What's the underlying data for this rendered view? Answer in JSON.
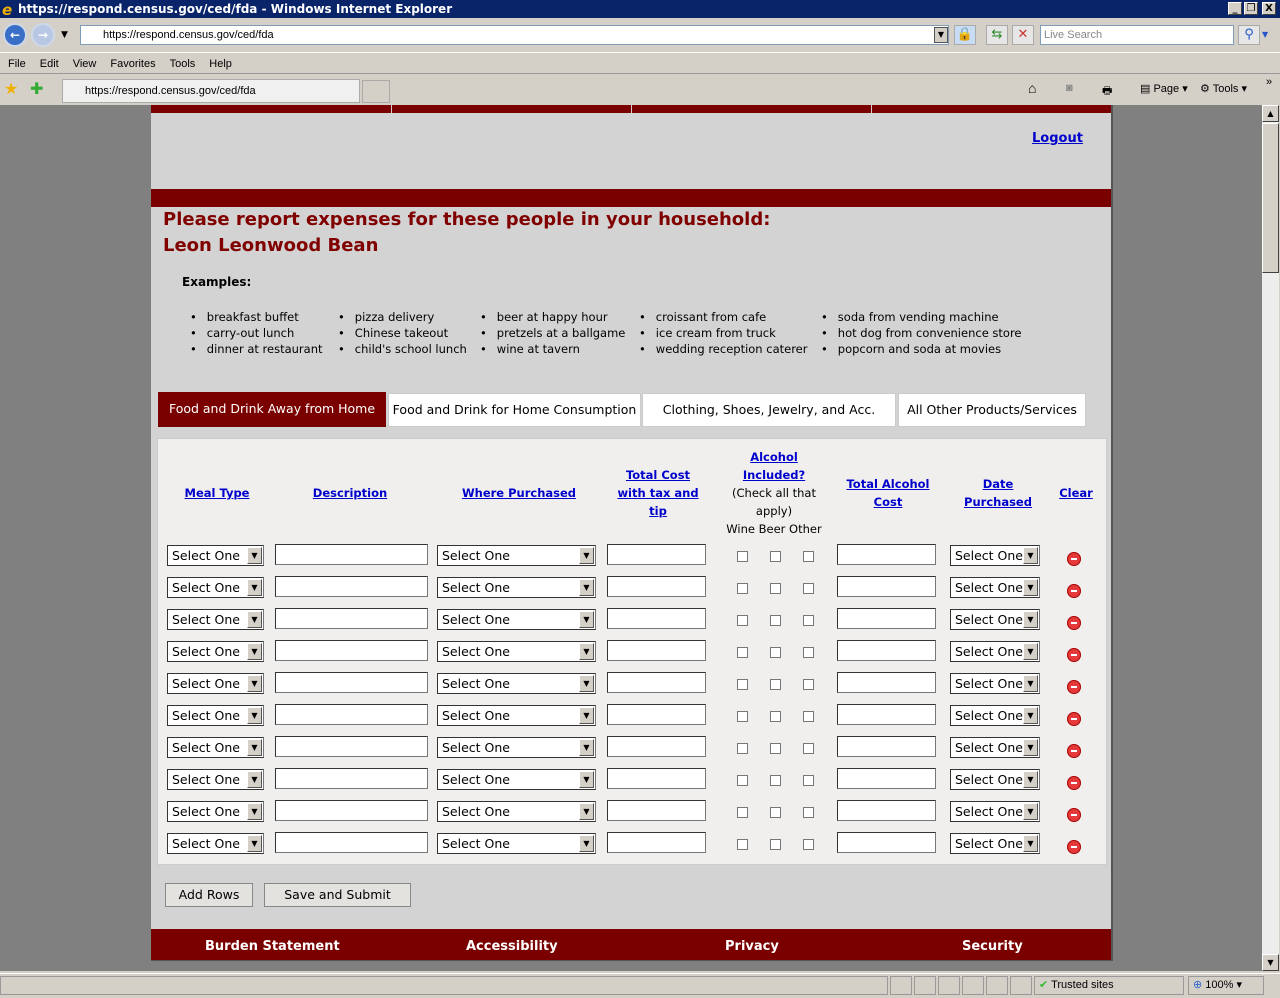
{
  "browser": {
    "title": "https://respond.census.gov/ced/fda - Windows Internet Explorer",
    "url": "https://respond.census.gov/ced/fda",
    "search_placeholder": "Live Search",
    "menu": [
      "File",
      "Edit",
      "View",
      "Favorites",
      "Tools",
      "Help"
    ],
    "tab_title": "https://respond.census.gov/ced/fda",
    "page_label": "Page",
    "tools_label": "Tools",
    "status_zone": "Trusted sites",
    "zoom": "100%"
  },
  "page": {
    "logout": "Logout",
    "heading1": "Please report expenses for these people in your household:",
    "heading2": "Leon Leonwood Bean",
    "examples_label": "Examples:",
    "examples": [
      [
        "breakfast buffet",
        "carry-out lunch",
        "dinner at restaurant"
      ],
      [
        "pizza delivery",
        "Chinese takeout",
        "child's school lunch"
      ],
      [
        "beer at happy hour",
        "pretzels at a ballgame",
        "wine at tavern"
      ],
      [
        "croissant from cafe",
        "ice cream from truck",
        "wedding reception caterer"
      ],
      [
        "soda from vending machine",
        "hot dog from convenience store",
        "popcorn and soda at movies"
      ]
    ],
    "tabs": [
      "Food and Drink Away from Home",
      "Food and Drink for Home Consumption",
      "Clothing, Shoes, Jewelry, and Acc.",
      "All Other Products/Services"
    ],
    "active_tab": 0,
    "columns": {
      "meal_type": "Meal Type",
      "description": "Description",
      "where": "Where Purchased",
      "total_cost": [
        "Total Cost",
        "with tax and",
        "tip"
      ],
      "alcohol": [
        "Alcohol",
        "Included?"
      ],
      "alcohol_note": [
        "(Check all that",
        "apply)"
      ],
      "alcohol_sub": "Wine Beer Other",
      "alcohol_cost": [
        "Total Alcohol",
        "Cost"
      ],
      "date": [
        "Date",
        "Purchased"
      ],
      "clear": "Clear"
    },
    "rows": [
      {
        "meal": "Select One",
        "description": "",
        "where": "Select One",
        "cost": "",
        "wine": false,
        "beer": false,
        "other": false,
        "alcohol_cost": "",
        "date": "Select One"
      },
      {
        "meal": "Select One",
        "description": "",
        "where": "Select One",
        "cost": "",
        "wine": false,
        "beer": false,
        "other": false,
        "alcohol_cost": "",
        "date": "Select One"
      },
      {
        "meal": "Select One",
        "description": "",
        "where": "Select One",
        "cost": "",
        "wine": false,
        "beer": false,
        "other": false,
        "alcohol_cost": "",
        "date": "Select One"
      },
      {
        "meal": "Select One",
        "description": "",
        "where": "Select One",
        "cost": "",
        "wine": false,
        "beer": false,
        "other": false,
        "alcohol_cost": "",
        "date": "Select One"
      },
      {
        "meal": "Select One",
        "description": "",
        "where": "Select One",
        "cost": "",
        "wine": false,
        "beer": false,
        "other": false,
        "alcohol_cost": "",
        "date": "Select One"
      },
      {
        "meal": "Select One",
        "description": "",
        "where": "Select One",
        "cost": "",
        "wine": false,
        "beer": false,
        "other": false,
        "alcohol_cost": "",
        "date": "Select One"
      },
      {
        "meal": "Select One",
        "description": "",
        "where": "Select One",
        "cost": "",
        "wine": false,
        "beer": false,
        "other": false,
        "alcohol_cost": "",
        "date": "Select One"
      },
      {
        "meal": "Select One",
        "description": "",
        "where": "Select One",
        "cost": "",
        "wine": false,
        "beer": false,
        "other": false,
        "alcohol_cost": "",
        "date": "Select One"
      },
      {
        "meal": "Select One",
        "description": "",
        "where": "Select One",
        "cost": "",
        "wine": false,
        "beer": false,
        "other": false,
        "alcohol_cost": "",
        "date": "Select One"
      },
      {
        "meal": "Select One",
        "description": "",
        "where": "Select One",
        "cost": "",
        "wine": false,
        "beer": false,
        "other": false,
        "alcohol_cost": "",
        "date": "Select One"
      }
    ],
    "add_rows": "Add Rows",
    "save_submit": "Save and Submit",
    "footer": [
      "Burden Statement",
      "Accessibility",
      "Privacy",
      "Security"
    ],
    "colors": {
      "brand": "#7a0000",
      "link": "#0000cc"
    }
  }
}
